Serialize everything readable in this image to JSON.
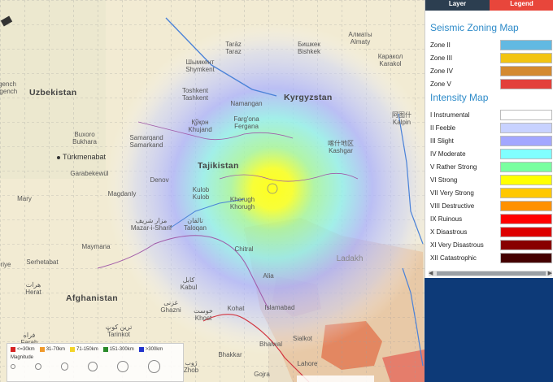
{
  "panel": {
    "tabs": [
      {
        "label": "Layer"
      },
      {
        "label": "Legend"
      }
    ],
    "seismic_title": "Seismic Zoning Map",
    "zones": [
      {
        "label": "Zone II",
        "color": "#62b9e2"
      },
      {
        "label": "Zone III",
        "color": "#f2c412"
      },
      {
        "label": "Zone IV",
        "color": "#d48a30"
      },
      {
        "label": "Zone V",
        "color": "#e3403b"
      }
    ],
    "intensity_title": "Intensity Map",
    "intensities": [
      {
        "label": "I Instrumental",
        "color": "#ffffff"
      },
      {
        "label": "II Feeble",
        "color": "#c8d2ff"
      },
      {
        "label": "III Slight",
        "color": "#a3a7ff"
      },
      {
        "label": "IV Moderate",
        "color": "#80ffff"
      },
      {
        "label": "V Rather Strong",
        "color": "#79ffa0"
      },
      {
        "label": "VI Strong",
        "color": "#ffff00"
      },
      {
        "label": "VII Very Strong",
        "color": "#ffc800"
      },
      {
        "label": "VIII Destructive",
        "color": "#ff9100"
      },
      {
        "label": "IX Ruinous",
        "color": "#ff0000"
      },
      {
        "label": "X Disastrous",
        "color": "#dd0000"
      },
      {
        "label": "XI Very Disastrous",
        "color": "#880000"
      },
      {
        "label": "XII Catastrophic",
        "color": "#440000"
      }
    ]
  },
  "map": {
    "countries": [
      "Uzbekistan",
      "Kyrgyzstan",
      "Tajikistan",
      "Afghanistan",
      "Türkmenabat"
    ],
    "cities": [
      {
        "name": "Tarāz",
        "sub": "Taraz"
      },
      {
        "name": "Бишкек",
        "sub": "Bishkek"
      },
      {
        "name": "Алматы",
        "sub": "Almaty"
      },
      {
        "name": "Каракол",
        "sub": "Karakol"
      },
      {
        "name": "Шымкент",
        "sub": "Shymkent"
      },
      {
        "name": "Toshkent",
        "sub": "Tashkent"
      },
      {
        "name": "Namangan",
        "sub": ""
      },
      {
        "name": "Қўқон",
        "sub": "Khujand"
      },
      {
        "name": "Farg'ona",
        "sub": "Fergana"
      },
      {
        "name": "喀什地区",
        "sub": "Kashgar"
      },
      {
        "name": "阿图什",
        "sub": "Kalpin"
      },
      {
        "name": "Buxoro",
        "sub": "Bukhara"
      },
      {
        "name": "Samarqand",
        "sub": "Samarkand"
      },
      {
        "name": "Garabekewül",
        "sub": ""
      },
      {
        "name": "Denov",
        "sub": ""
      },
      {
        "name": "Magdanly",
        "sub": ""
      },
      {
        "name": "Mary",
        "sub": ""
      },
      {
        "name": "Kulob",
        "sub": "Kulob"
      },
      {
        "name": "Khorugh",
        "sub": "Khorugh"
      },
      {
        "name": "مزار شریف",
        "sub": "Mazar-i-Sharif"
      },
      {
        "name": "تالقان",
        "sub": "Taloqan"
      },
      {
        "name": "Maymana",
        "sub": ""
      },
      {
        "name": "Serhetabat",
        "sub": ""
      },
      {
        "name": "هرات",
        "sub": "Herat"
      },
      {
        "name": "Chitral",
        "sub": ""
      },
      {
        "name": "Alia",
        "sub": ""
      },
      {
        "name": "کابل",
        "sub": "Kabul"
      },
      {
        "name": "غزنی",
        "sub": "Ghazni"
      },
      {
        "name": "Kohat",
        "sub": ""
      },
      {
        "name": "Islamabad",
        "sub": ""
      },
      {
        "name": "خوست",
        "sub": "Khost"
      },
      {
        "name": "Bhalwal",
        "sub": ""
      },
      {
        "name": "Sialkot",
        "sub": ""
      },
      {
        "name": "ترین کوټ",
        "sub": "Tarinkot"
      },
      {
        "name": "فراه",
        "sub": "Farah"
      },
      {
        "name": "Bhakkar",
        "sub": ""
      },
      {
        "name": "ژوب",
        "sub": "Zhob"
      },
      {
        "name": "Gojra",
        "sub": ""
      },
      {
        "name": "Lahore",
        "sub": ""
      },
      {
        "name": "Ladakh",
        "sub": ""
      },
      {
        "name": "gench",
        "sub": ""
      },
      {
        "name": "rgench",
        "sub": ""
      },
      {
        "name": "riye",
        "sub": ""
      }
    ]
  },
  "scale_legend": {
    "distances": [
      {
        "label": "<=30km",
        "color": "#d62222"
      },
      {
        "label": "31-70km",
        "color": "#f09a2c"
      },
      {
        "label": "71-150km",
        "color": "#f3d42a"
      },
      {
        "label": "151-300km",
        "color": "#2a8a2a"
      },
      {
        "label": ">300km",
        "color": "#2233cc"
      }
    ],
    "magnitude_label": "Magnitude"
  }
}
